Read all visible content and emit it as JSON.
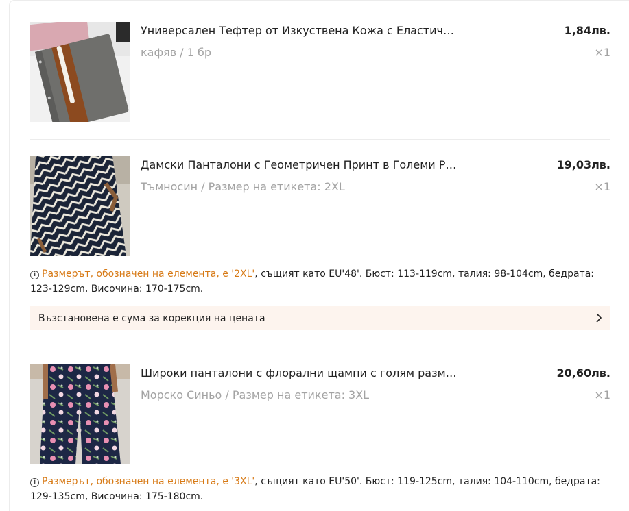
{
  "items": [
    {
      "title": "Универсален Тефтер от Изкуствена Кожа с Еластично Закопчаване и Държач за Химикалка",
      "price": "1,84лв.",
      "variant": "кафяв / 1 бр",
      "qty": "×1",
      "image_icon": "notebook-image"
    },
    {
      "title": "Дамски Панталони с Геометричен Принт в Големи Размери - Тъмносини Широки Панталони",
      "price": "19,03лв.",
      "variant": "Тъмносин / Размер на етикета: 2XL",
      "qty": "×1",
      "image_icon": "geometric-pants-image",
      "size_note": {
        "icon": "ⓘ",
        "highlight": "Размерът, обозначен на елемента, е '2XL'",
        "rest": ", същият като EU'48'. Бюст: 113-119cm, талия: 98-104cm, бедрата: 123-129cm, Височина: 170-175cm."
      }
    },
    {
      "title": "Широки панталони с флорални щампи с голям размер, елегантни свободни панталони",
      "price": "20,60лв.",
      "variant": "Морско Синьо / Размер на етикета: 3XL",
      "qty": "×1",
      "image_icon": "floral-pants-image",
      "size_note": {
        "icon": "ⓘ",
        "highlight": "Размерът, обозначен на елемента, е '3XL'",
        "rest": ", същият като EU'50'. Бюст: 119-125cm, талия: 104-110cm, бедрата: 129-135cm, Височина: 175-180cm."
      }
    }
  ],
  "price_adjust_banner": {
    "text": "Възстановена е сума за корекция на цената",
    "icon": "chevron-right-icon"
  },
  "colors": {
    "highlight": "#d77a16",
    "muted": "#a3a3a3",
    "banner_bg": "#fdf4ee",
    "divider": "#ececec"
  }
}
